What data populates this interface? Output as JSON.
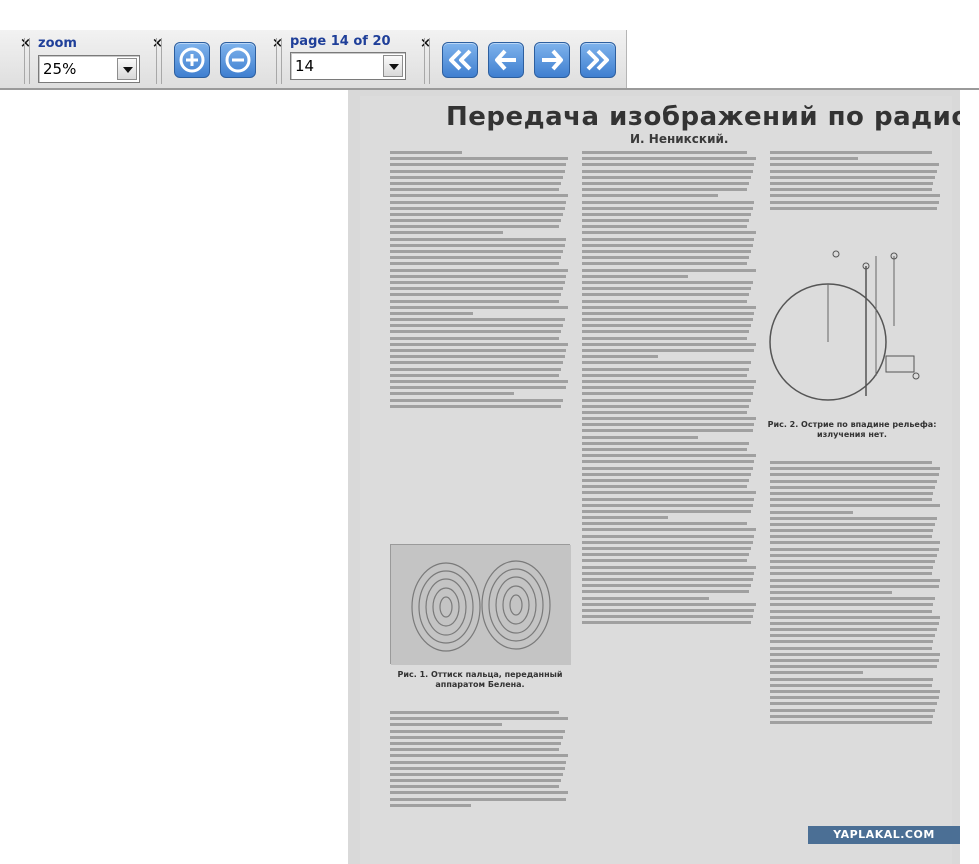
{
  "toolbar": {
    "zoom": {
      "label": "zoom",
      "value": "25%"
    },
    "page": {
      "label": "page 14 of 20",
      "value": "14"
    }
  },
  "document": {
    "title": "Передача изображений по радио",
    "author": "И. Неникский.",
    "figure1_caption": "Рис. 1. Оттиск пальца, переданный аппаратом Белена.",
    "figure2_caption": "Рис. 2. Острие по впадине рельефа: излучения нет."
  },
  "watermark": "YAPLAKAL.COM",
  "colors": {
    "label_blue": "#1f3f99",
    "button_blue": "#3f7fd0",
    "paper_gray": "#dcdcdc"
  }
}
